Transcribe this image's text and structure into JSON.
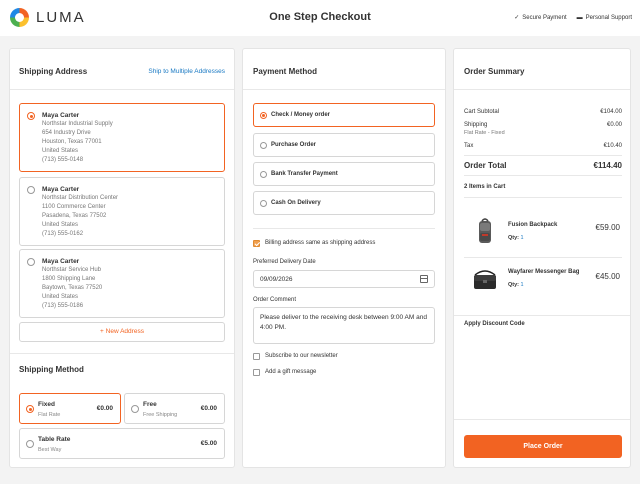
{
  "header": {
    "logo_text": "LUMA",
    "title": "One Step Checkout",
    "secure_payment": "Secure Payment",
    "personal_support": "Personal Support"
  },
  "shipping_address": {
    "title": "Shipping Address",
    "multi_link": "Ship to Multiple Addresses",
    "addresses": [
      {
        "name": "Maya Carter",
        "company": "Northstar Industrial Supply",
        "street": "654 Industry Drive",
        "city": "Houston, Texas 77001",
        "country": "United States",
        "phone": "(713) 555-0148",
        "selected": true
      },
      {
        "name": "Maya Carter",
        "company": "Northstar Distribution Center",
        "street": "1100 Commerce Center",
        "city": "Pasadena, Texas 77502",
        "country": "United States",
        "phone": "(713) 555-0162",
        "selected": false
      },
      {
        "name": "Maya Carter",
        "company": "Northstar Service Hub",
        "street": "1800 Shipping Lane",
        "city": "Baytown, Texas 77520",
        "country": "United States",
        "phone": "(713) 555-0186",
        "selected": false
      }
    ],
    "new_address": "+ New Address"
  },
  "shipping_method": {
    "title": "Shipping Method",
    "options": [
      {
        "name": "Fixed",
        "sub": "Flat Rate",
        "price": "€0.00",
        "selected": true
      },
      {
        "name": "Free",
        "sub": "Free Shipping",
        "price": "€0.00",
        "selected": false
      },
      {
        "name": "Table Rate",
        "sub": "Best Way",
        "price": "€5.00",
        "selected": false
      }
    ]
  },
  "payment": {
    "title": "Payment Method",
    "methods": [
      {
        "label": "Check / Money order",
        "selected": true
      },
      {
        "label": "Purchase Order",
        "selected": false
      },
      {
        "label": "Bank Transfer Payment",
        "selected": false
      },
      {
        "label": "Cash On Delivery",
        "selected": false
      }
    ],
    "billing_same": "Billing address same as shipping address",
    "delivery_label": "Preferred Delivery Date",
    "delivery_value": "09/09/2026",
    "comment_label": "Order Comment",
    "comment_value": "Please deliver to the receiving desk between 9:00 AM and 4:00 PM.",
    "newsletter": "Subscribe to our newsletter",
    "gift": "Add a gift message"
  },
  "summary": {
    "title": "Order Summary",
    "subtotal_label": "Cart Subtotal",
    "subtotal_value": "€104.00",
    "shipping_label": "Shipping",
    "shipping_sub": "Flat Rate - Fixed",
    "shipping_value": "€0.00",
    "tax_label": "Tax",
    "tax_value": "€10.40",
    "total_label": "Order Total",
    "total_value": "€114.40",
    "items_count": "2 Items in Cart",
    "items": [
      {
        "name": "Fusion Backpack",
        "qty_label": "Qty:",
        "qty": "1",
        "price": "€59.00"
      },
      {
        "name": "Wayfarer Messenger Bag",
        "qty_label": "Qty:",
        "qty": "1",
        "price": "€45.00"
      }
    ],
    "discount": "Apply Discount Code",
    "place_order": "Place Order"
  },
  "colors": {
    "accent": "#f26322",
    "link": "#1979c3"
  }
}
